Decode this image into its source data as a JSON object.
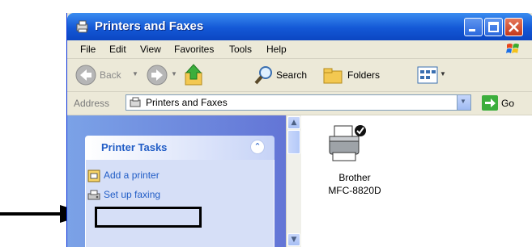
{
  "window": {
    "title": "Printers and Faxes"
  },
  "menu": {
    "items": [
      "File",
      "Edit",
      "View",
      "Favorites",
      "Tools",
      "Help"
    ]
  },
  "toolbar": {
    "back": "Back",
    "search": "Search",
    "folders": "Folders"
  },
  "address": {
    "label": "Address",
    "value": "Printers and Faxes",
    "go": "Go"
  },
  "taskpane": {
    "title": "Printer Tasks",
    "items": [
      "Add a printer",
      "Set up faxing"
    ]
  },
  "printer": {
    "name_line1": "Brother",
    "name_line2": "MFC-8820D"
  },
  "colors": {
    "title_blue": "#1458d6",
    "task_link": "#215dc6",
    "pane_blue": "#6f8fe0"
  }
}
